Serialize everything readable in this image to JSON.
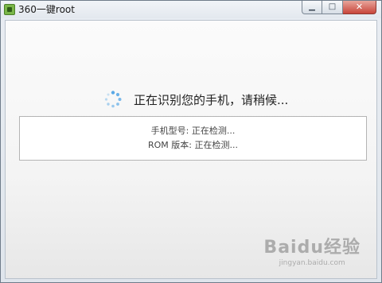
{
  "window": {
    "title": "360一键root",
    "controls": {
      "minimize_icon": "minimize-icon",
      "maximize_icon": "maximize-icon",
      "close_icon": "close-icon"
    }
  },
  "status": {
    "text": "正在识别您的手机，请稍候..."
  },
  "device_info": {
    "model_line": "手机型号: 正在检测...",
    "rom_line": "ROM 版本: 正在检测..."
  },
  "watermark": {
    "logo": "Baidu经验",
    "url": "jingyan.baidu.com"
  },
  "colors": {
    "spinner": "#5aa9e6",
    "close_button": "#c8453a"
  }
}
